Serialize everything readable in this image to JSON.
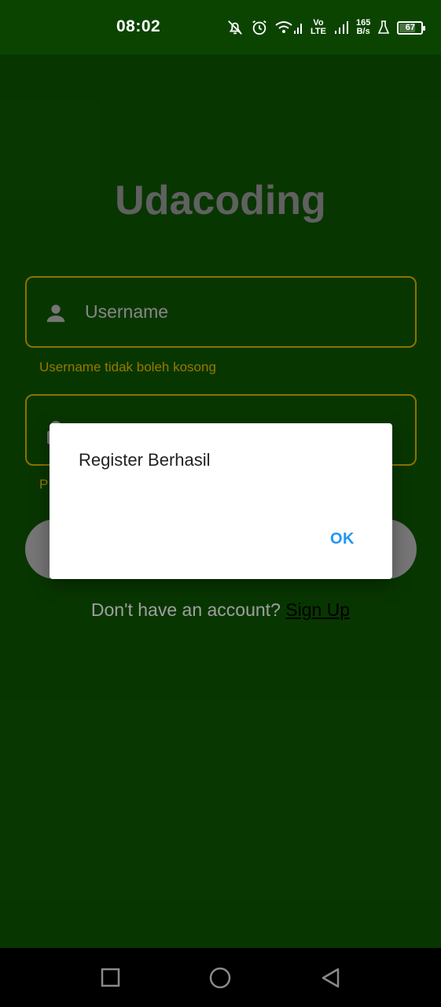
{
  "status_bar": {
    "time": "08:02",
    "volte_top": "Vo",
    "volte_bottom": "LTE",
    "speed_value": "165",
    "speed_unit": "B/s",
    "battery": "67",
    "battery_fraction": 0.67
  },
  "login": {
    "title": "Udacoding",
    "username_placeholder": "Username",
    "username_error": "Username tidak boleh kosong",
    "password_error_char": "P",
    "signup_prompt": "Don't have an account?",
    "signup_link": "Sign Up"
  },
  "dialog": {
    "title": "Register Berhasil",
    "ok_label": "OK"
  },
  "colors": {
    "background": "#0e5802",
    "status_bar": "#0b4401",
    "accent_border": "#e6b800",
    "dialog_button": "#2196f3"
  },
  "icons": {
    "username": "person-icon",
    "password": "lock-icon",
    "nav_recents": "square-icon",
    "nav_home": "circle-icon",
    "nav_back": "triangle-back-icon"
  }
}
